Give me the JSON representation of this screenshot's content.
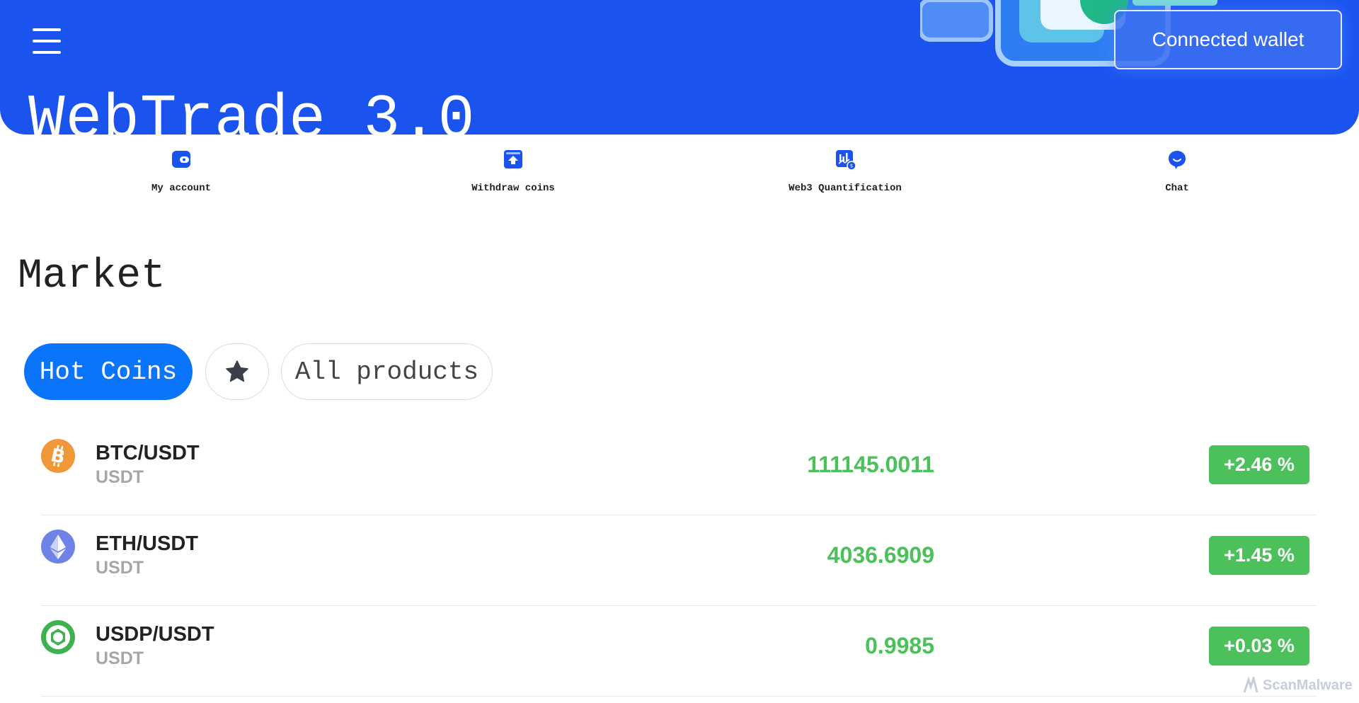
{
  "header": {
    "menu_icon": "hamburger-menu-icon",
    "app_title": "WebTrade 3.0",
    "wallet_button": "Connected wallet",
    "brand_color": "#1a53ee"
  },
  "quick_nav": [
    {
      "label": "My account",
      "icon": "wallet-icon"
    },
    {
      "label": "Withdraw coins",
      "icon": "withdraw-box-icon"
    },
    {
      "label": "Web3 Quantification",
      "icon": "quant-chart-icon"
    },
    {
      "label": "Chat",
      "icon": "chat-bubble-icon"
    }
  ],
  "market": {
    "title": "Market",
    "tabs": [
      {
        "label": "Hot Coins",
        "active": true
      },
      {
        "label": "",
        "icon": "star-icon",
        "active": false
      },
      {
        "label": "All products",
        "active": false
      }
    ],
    "coins": [
      {
        "pair": "BTC/USDT",
        "quote": "USDT",
        "price": "111145.0011",
        "change": "+2.46 %",
        "icon": "bitcoin-icon"
      },
      {
        "pair": "ETH/USDT",
        "quote": "USDT",
        "price": "4036.6909",
        "change": "+1.45 %",
        "icon": "ethereum-icon"
      },
      {
        "pair": "USDP/USDT",
        "quote": "USDT",
        "price": "0.9985",
        "change": "+0.03 %",
        "icon": "usdp-icon"
      }
    ],
    "positive_color": "#4cc05a",
    "tab_active_color": "#0a74fb"
  },
  "watermark": {
    "text": "ScanMalware"
  }
}
